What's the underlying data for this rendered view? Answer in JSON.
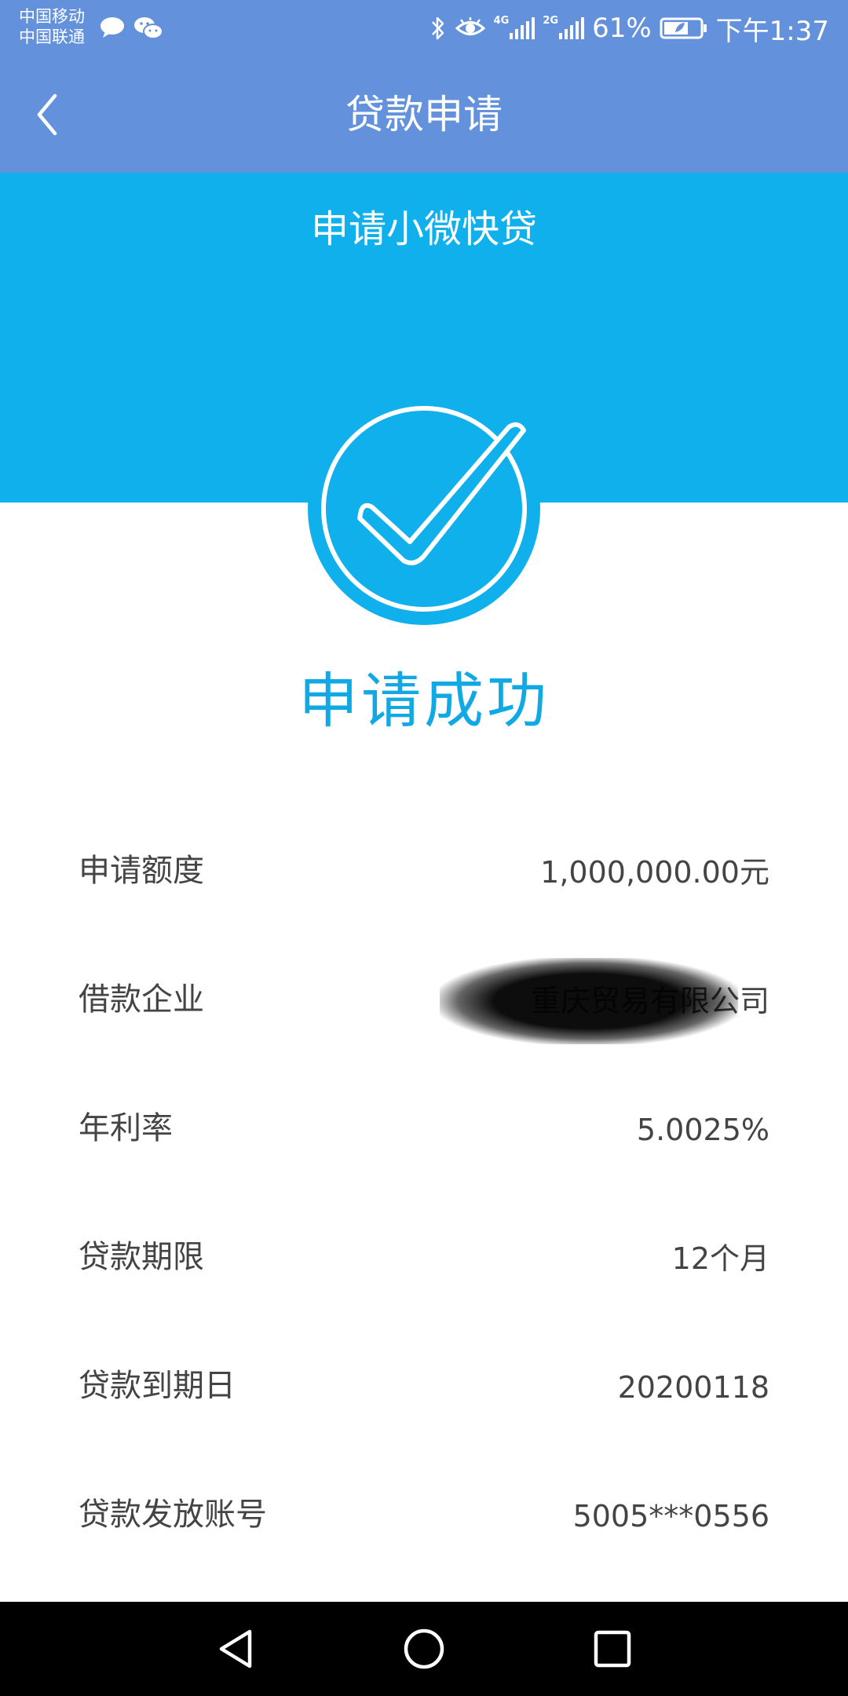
{
  "status_bar": {
    "carrier_1": "中国移动",
    "carrier_2": "中国联通",
    "battery": "61%",
    "time": "下午1:37",
    "net_1": "4G",
    "net_2": "2G",
    "icons": [
      "message-icon",
      "wechat-icon",
      "bluetooth-icon",
      "eye-icon",
      "signal-icon",
      "signal-icon",
      "battery-icon"
    ]
  },
  "header": {
    "title": "贷款申请",
    "back_icon": "chevron-left-icon"
  },
  "banner": {
    "title": "申请小微快贷"
  },
  "result": {
    "status": "申请成功",
    "icon": "check-circle-icon"
  },
  "details": [
    {
      "label": "申请额度",
      "value": "1,000,000.00元"
    },
    {
      "label": "借款企业",
      "value": "重庆贸易有限公司"
    },
    {
      "label": "年利率",
      "value": "5.0025%"
    },
    {
      "label": "贷款期限",
      "value": "12个月"
    },
    {
      "label": "贷款到期日",
      "value": "20200118"
    },
    {
      "label": "贷款发放账号",
      "value": "5005***0556"
    }
  ],
  "nav": {
    "buttons": [
      "back-triangle-icon",
      "home-circle-icon",
      "recents-square-icon"
    ]
  },
  "colors": {
    "header": "#6391dc",
    "banner": "#10b0ec",
    "accent_text": "#10a9e4",
    "text": "#444444",
    "nav": "#000000"
  }
}
